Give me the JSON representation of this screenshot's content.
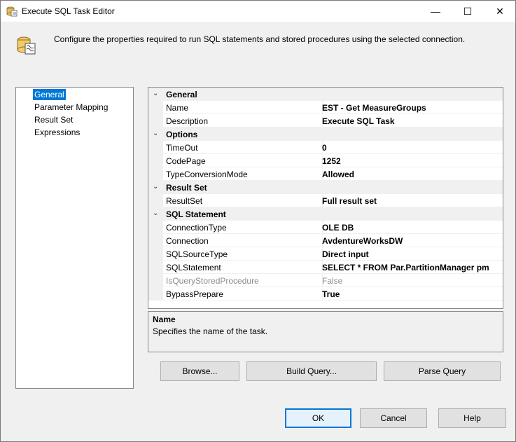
{
  "window": {
    "title": "Execute SQL Task Editor",
    "min_glyph": "—",
    "max_glyph": "☐",
    "close_glyph": "✕"
  },
  "header": {
    "description": "Configure the properties required to run SQL statements and stored procedures using the selected connection."
  },
  "nav": {
    "items": [
      {
        "label": "General",
        "selected": true
      },
      {
        "label": "Parameter Mapping"
      },
      {
        "label": "Result Set"
      },
      {
        "label": "Expressions"
      }
    ]
  },
  "grid": {
    "categories": [
      {
        "label": "General",
        "rows": [
          {
            "name": "Name",
            "value": "EST - Get MeasureGroups"
          },
          {
            "name": "Description",
            "value": "Execute SQL Task"
          }
        ]
      },
      {
        "label": "Options",
        "rows": [
          {
            "name": "TimeOut",
            "value": "0"
          },
          {
            "name": "CodePage",
            "value": "1252"
          },
          {
            "name": "TypeConversionMode",
            "value": "Allowed"
          }
        ]
      },
      {
        "label": "Result Set",
        "rows": [
          {
            "name": "ResultSet",
            "value": "Full result set"
          }
        ]
      },
      {
        "label": "SQL Statement",
        "rows": [
          {
            "name": "ConnectionType",
            "value": "OLE DB"
          },
          {
            "name": "Connection",
            "value": "AvdentureWorksDW"
          },
          {
            "name": "SQLSourceType",
            "value": "Direct input"
          },
          {
            "name": "SQLStatement",
            "value": "SELECT * FROM Par.PartitionManager pm"
          },
          {
            "name": "IsQueryStoredProcedure",
            "value": "False",
            "disabled": true
          },
          {
            "name": "BypassPrepare",
            "value": "True"
          }
        ]
      }
    ]
  },
  "description_panel": {
    "title": "Name",
    "text": "Specifies the name of the task."
  },
  "buttons": {
    "browse": "Browse...",
    "build_query": "Build Query...",
    "parse_query": "Parse Query",
    "ok": "OK",
    "cancel": "Cancel",
    "help": "Help"
  },
  "colors": {
    "selection": "#0078d7",
    "dialog_bg": "#f0f0f0"
  }
}
